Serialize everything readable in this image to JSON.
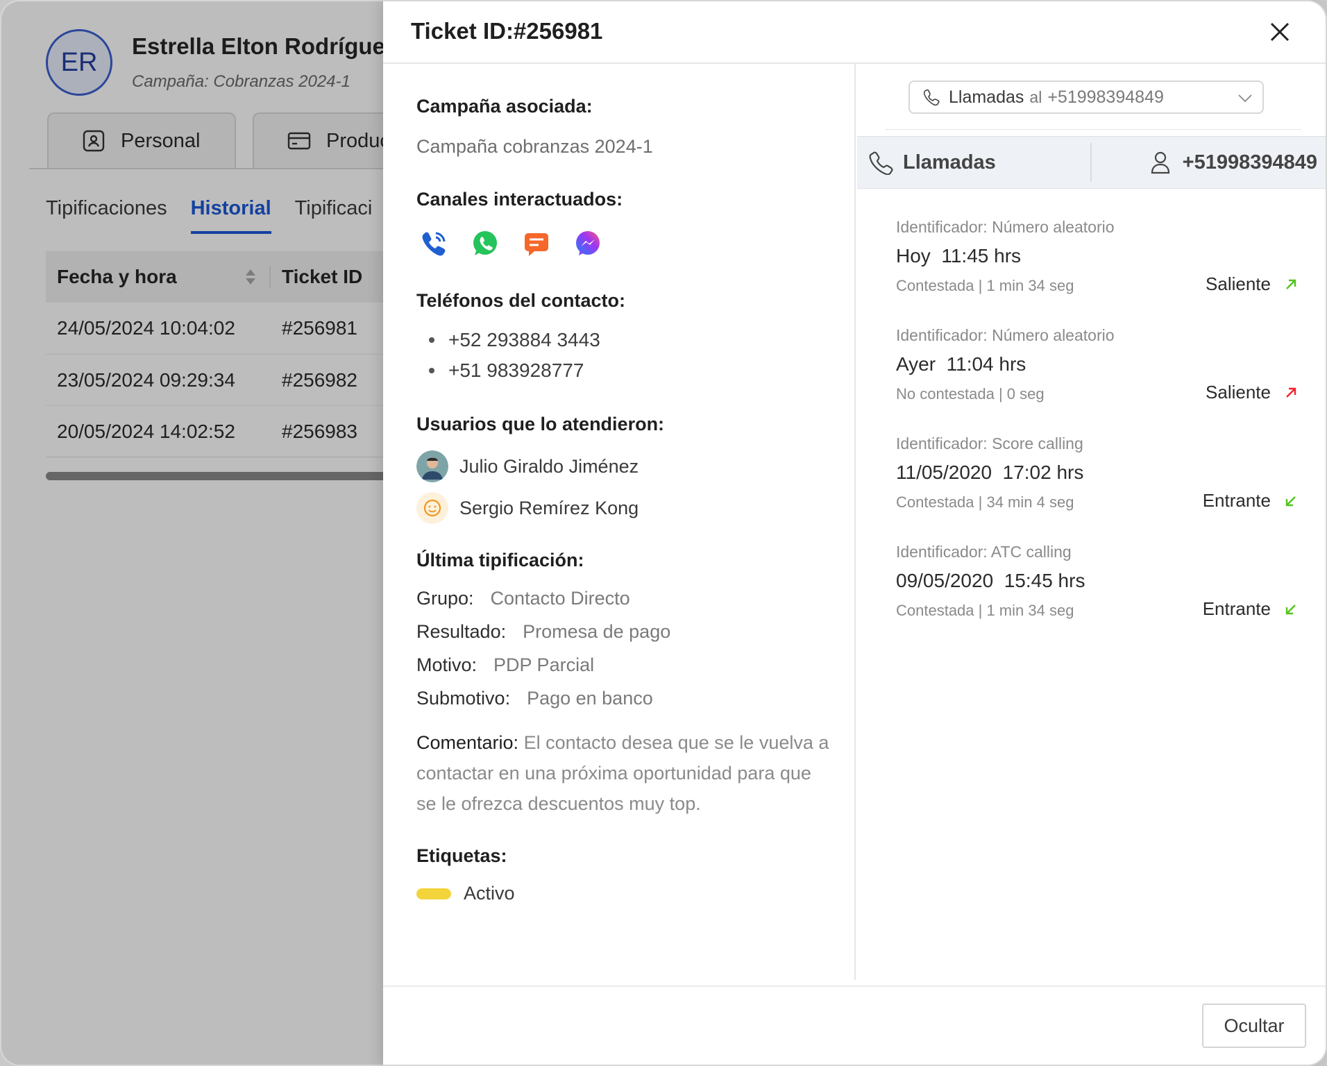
{
  "background": {
    "contact": {
      "initials": "ER",
      "name": "Estrella Elton Rodríguez",
      "campaign": "Campaña: Cobranzas 2024-1"
    },
    "section_tabs": [
      {
        "label": "Personal",
        "icon": "id-card-icon"
      },
      {
        "label": "Produc",
        "icon": "credit-card-icon"
      }
    ],
    "sub_tabs": [
      {
        "label": "Tipificaciones",
        "active": false
      },
      {
        "label": "Historial",
        "active": true
      },
      {
        "label": "Tipificaci",
        "active": false
      }
    ],
    "history_table": {
      "headers": [
        "Fecha y hora",
        "Ticket ID"
      ],
      "rows": [
        {
          "date": "24/05/2024 10:04:02",
          "ticket": "#256981"
        },
        {
          "date": "23/05/2024 09:29:34",
          "ticket": "#256982"
        },
        {
          "date": "20/05/2024 14:02:52",
          "ticket": "#256983"
        }
      ]
    }
  },
  "modal": {
    "title": "Ticket ID:#256981",
    "campaign_label": "Campaña asociada:",
    "campaign_value": "Campaña cobranzas 2024-1",
    "channels_label": "Canales interactuados:",
    "channels": [
      "phone-call-icon",
      "whatsapp-icon",
      "chat-icon",
      "messenger-icon"
    ],
    "phones_label": "Teléfonos del contacto:",
    "phones": [
      "+52 293884 3443",
      "+51 983928777"
    ],
    "users_label": "Usuarios que lo atendieron:",
    "users": [
      "Julio Giraldo Jiménez",
      "Sergio Remírez Kong"
    ],
    "last_tip_label": "Última tipificación:",
    "tipification": {
      "group_key": "Grupo:",
      "group_val": "Contacto Directo",
      "result_key": "Resultado:",
      "result_val": "Promesa de pago",
      "reason_key": "Motivo:",
      "reason_val": "PDP Parcial",
      "subreason_key": "Submotivo:",
      "subreason_val": "Pago en banco"
    },
    "comment_key": "Comentario:",
    "comment_text": "El contacto desea que se le vuelva a contactar en una próxima oportunidad para que se le ofrezca descuentos muy top.",
    "tags_label": "Etiquetas:",
    "tags": [
      {
        "label": "Activo",
        "color": "#f3d43b"
      }
    ],
    "select": {
      "channel": "Llamadas",
      "connector": "al",
      "number": "+51998394849"
    },
    "call_bar": {
      "channel": "Llamadas",
      "number": "+51998394849"
    },
    "calls": [
      {
        "identifier": "Identificador: Número aleatorio",
        "when": "Hoy",
        "time": "11:45 hrs",
        "status": "Contestada | 1 min 34 seg",
        "direction": "Saliente",
        "arrow_color": "#52c41a"
      },
      {
        "identifier": "Identificador: Número aleatorio",
        "when": "Ayer",
        "time": "11:04 hrs",
        "status": "No contestada | 0 seg",
        "direction": "Saliente",
        "arrow_color": "#f5222d"
      },
      {
        "identifier": "Identificador: Score calling",
        "when": "11/05/2020",
        "time": "17:02 hrs",
        "status": "Contestada | 34 min 4 seg",
        "direction": "Entrante",
        "arrow_color": "#52c41a"
      },
      {
        "identifier": "Identificador: ATC calling",
        "when": "09/05/2020",
        "time": "15:45 hrs",
        "status": "Contestada | 1 min 34 seg",
        "direction": "Entrante",
        "arrow_color": "#52c41a"
      }
    ],
    "hide_button": "Ocultar"
  }
}
